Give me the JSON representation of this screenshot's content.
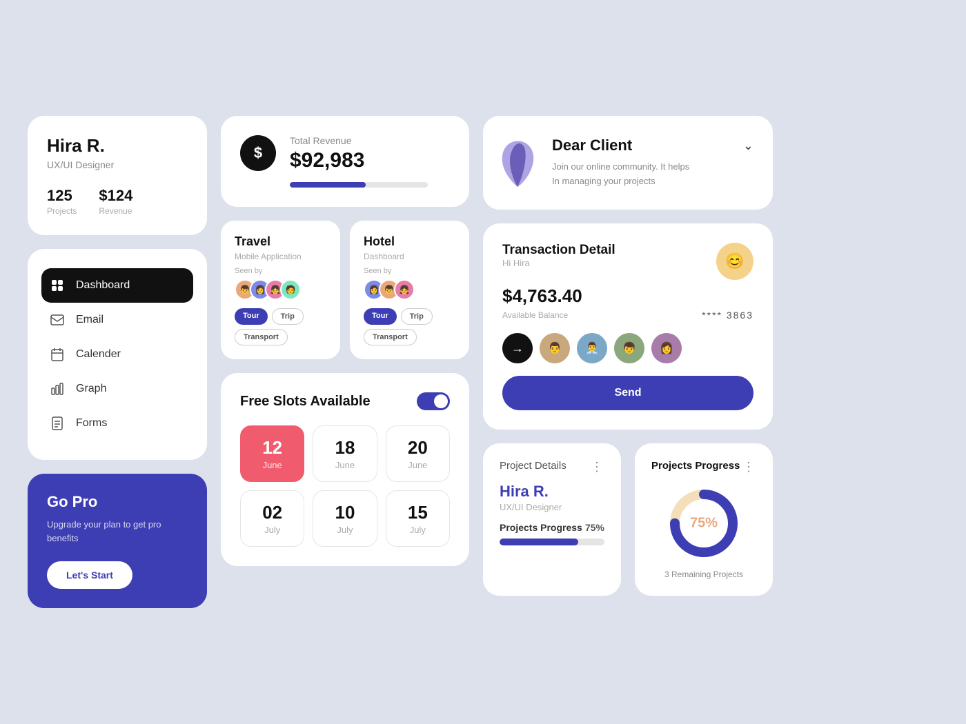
{
  "profile": {
    "name": "Hira R.",
    "title": "UX/UI Designer",
    "projects_count": "125",
    "projects_label": "Projects",
    "revenue_val": "$124",
    "revenue_label": "Revenue"
  },
  "nav": {
    "items": [
      {
        "id": "dashboard",
        "label": "Dashboard",
        "active": true
      },
      {
        "id": "email",
        "label": "Email",
        "active": false
      },
      {
        "id": "calendar",
        "label": "Calender",
        "active": false
      },
      {
        "id": "graph",
        "label": "Graph",
        "active": false
      },
      {
        "id": "forms",
        "label": "Forms",
        "active": false
      }
    ]
  },
  "gopro": {
    "title": "Go Pro",
    "desc": "Upgrade your plan to get pro benefits",
    "btn_label": "Let's Start"
  },
  "revenue": {
    "label": "Total Revenue",
    "amount": "$92,983",
    "progress": 55
  },
  "projects": [
    {
      "type": "Travel",
      "sub": "Mobile Application",
      "seen_label": "Seen by",
      "tags": [
        "Tour",
        "Trip",
        "Transport"
      ]
    },
    {
      "type": "Hotel",
      "sub": "Dashboard",
      "seen_label": "Seen by",
      "tags": [
        "Tour",
        "Trip",
        "Transport"
      ]
    }
  ],
  "slots": {
    "title": "Free Slots Available",
    "dates": [
      {
        "num": "12",
        "month": "June",
        "selected": true
      },
      {
        "num": "18",
        "month": "June",
        "selected": false
      },
      {
        "num": "20",
        "month": "June",
        "selected": false
      },
      {
        "num": "02",
        "month": "July",
        "selected": false
      },
      {
        "num": "10",
        "month": "July",
        "selected": false
      },
      {
        "num": "15",
        "month": "July",
        "selected": false
      }
    ]
  },
  "dear_client": {
    "title": "Dear Client",
    "desc_line1": "Join our online community. It helps",
    "desc_line2": "In managing your projects"
  },
  "transaction": {
    "title": "Transaction Detail",
    "greeting": "Hi Hira",
    "amount": "$4,763.40",
    "balance_label": "Available Balance",
    "card_num": "**** 3863",
    "send_btn": "Send"
  },
  "project_details": {
    "card_title": "Project Details",
    "name": "Hira R.",
    "role": "UX/UI Designer",
    "progress_label": "Projects Progress",
    "progress_pct": "75%",
    "progress_val": 75
  },
  "projects_progress": {
    "title": "Projects Progress",
    "pct": "75%",
    "pct_val": 75,
    "remaining": "3 Remaining Projects"
  }
}
